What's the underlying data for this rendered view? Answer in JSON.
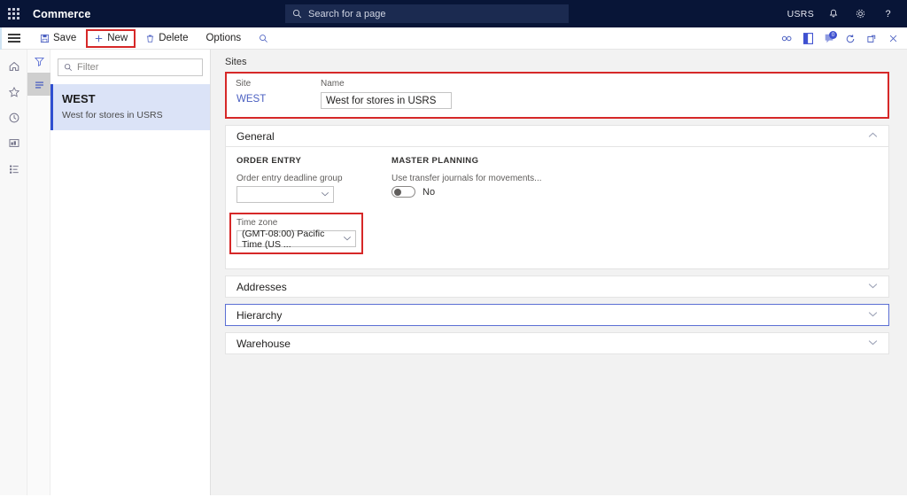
{
  "topbar": {
    "waffle_icon": "app-launcher-icon",
    "app_title": "Commerce",
    "search_placeholder": "Search for a page",
    "search_icon": "search-icon",
    "user_initials": "USRS",
    "bell_icon": "notifications-icon",
    "gear_icon": "settings-icon",
    "help_icon": "help-icon"
  },
  "commandbar": {
    "hamburger_icon": "hamburger-menu-icon",
    "save_label": "Save",
    "save_icon": "save-icon",
    "new_label": "New",
    "new_icon": "plus-icon",
    "delete_label": "Delete",
    "delete_icon": "trash-icon",
    "options_label": "Options",
    "search_icon": "search-icon",
    "right_icons": [
      {
        "name": "attach-link-icon",
        "glyph": "∞"
      },
      {
        "name": "office-app-icon",
        "glyph": ""
      },
      {
        "name": "messages-icon",
        "glyph": "",
        "badge": "0"
      },
      {
        "name": "refresh-icon",
        "glyph": "↻"
      },
      {
        "name": "popout-icon",
        "glyph": "⬏"
      },
      {
        "name": "close-icon",
        "glyph": "✕"
      }
    ]
  },
  "rail": {
    "items": [
      {
        "name": "home-icon",
        "label": "Home"
      },
      {
        "name": "star-icon",
        "label": "Favorites"
      },
      {
        "name": "clock-icon",
        "label": "Recent"
      },
      {
        "name": "workspaces-icon",
        "label": "Workspaces"
      },
      {
        "name": "modules-icon",
        "label": "Modules"
      }
    ]
  },
  "listpanel": {
    "tabs": [
      {
        "name": "filter-tab",
        "icon": "funnel-icon",
        "active": false
      },
      {
        "name": "list-tab",
        "icon": "list-lines-icon",
        "active": true
      }
    ],
    "filter_placeholder": "Filter",
    "filter_icon": "search-icon",
    "items": [
      {
        "title": "WEST",
        "subtitle": "West for stores in USRS"
      }
    ]
  },
  "main": {
    "page_title": "Sites",
    "header_fields": {
      "site_label": "Site",
      "site_value": "WEST",
      "name_label": "Name",
      "name_value": "West for stores in USRS",
      "name_placeholder": ""
    },
    "sections": [
      {
        "title": "General",
        "expanded": true,
        "chevron": "chevron-up-icon",
        "focused": false,
        "groups": [
          {
            "title": "ORDER ENTRY",
            "fields": [
              {
                "type": "combo",
                "label": "Order entry deadline group",
                "value": "",
                "highlight": false
              },
              {
                "type": "combo",
                "label": "Time zone",
                "value": "(GMT-08:00) Pacific Time (US ...",
                "highlight": true
              }
            ]
          },
          {
            "title": "MASTER PLANNING",
            "fields": [
              {
                "type": "toggle",
                "label": "Use transfer journals for movements...",
                "value": "No",
                "checked": false
              }
            ]
          }
        ]
      },
      {
        "title": "Addresses",
        "expanded": false,
        "chevron": "chevron-down-icon",
        "focused": false
      },
      {
        "title": "Hierarchy",
        "expanded": false,
        "chevron": "chevron-down-icon",
        "focused": true
      },
      {
        "title": "Warehouse",
        "expanded": false,
        "chevron": "chevron-down-icon",
        "focused": false
      }
    ]
  },
  "colors": {
    "nav_background": "#081537",
    "accent_blue": "#2f4fd0",
    "highlight_red": "#d62828",
    "selected_row": "#dbe3f7",
    "link_text": "#4a5fc1"
  }
}
